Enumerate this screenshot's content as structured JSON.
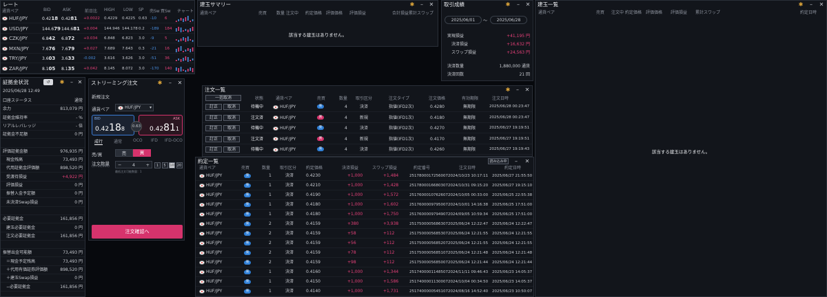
{
  "rates": {
    "title": "レート",
    "cols": [
      "通貨ペア",
      "BID",
      "ASK",
      "前日比",
      "HIGH",
      "LOW",
      "SP",
      "売Sw",
      "買Sw",
      "チャート"
    ],
    "rows": [
      {
        "pair": "HUF/JPY",
        "bid_a": "0.42",
        "bid_b": "18",
        "ask_a": "0.42",
        "ask_b": "81",
        "chg": "+0.0022",
        "high": "0.4229",
        "low": "0.4225",
        "sp": "0.63",
        "sw_sell": "-10",
        "sw_buy": "6",
        "chg_color": "red"
      },
      {
        "pair": "USD/JPY",
        "bid_a": "144.6",
        "bid_b": "79",
        "ask_a": "144.6",
        "ask_b": "81",
        "chg": "+0.004",
        "high": "144.946",
        "low": "144.178",
        "sp": "0.2",
        "sw_sell": "-189",
        "sw_buy": "184",
        "chg_color": "red"
      },
      {
        "pair": "CZK/JPY",
        "bid_a": "6.8",
        "bid_b": "42",
        "ask_a": "6.8",
        "ask_b": "72",
        "chg": "+0.034",
        "high": "6.848",
        "low": "6.823",
        "sp": "3.0",
        "sw_sell": "-9",
        "sw_buy": "5",
        "chg_color": "red"
      },
      {
        "pair": "MXN/JPY",
        "bid_a": "7.6",
        "bid_b": "76",
        "ask_a": "7.6",
        "ask_b": "79",
        "chg": "+0.027",
        "high": "7.689",
        "low": "7.643",
        "sp": "0.3",
        "sw_sell": "-21",
        "sw_buy": "16",
        "chg_color": "red"
      },
      {
        "pair": "TRY/JPY",
        "bid_a": "3.6",
        "bid_b": "03",
        "ask_a": "3.6",
        "ask_b": "33",
        "chg": "-0.002",
        "high": "3.616",
        "low": "3.626",
        "sp": "3.0",
        "sw_sell": "-51",
        "sw_buy": "36",
        "chg_color": "blu"
      },
      {
        "pair": "ZAR/JPY",
        "bid_a": "8.1",
        "bid_b": "05",
        "ask_a": "8.1",
        "ask_b": "35",
        "chg": "+0.042",
        "high": "8.145",
        "low": "8.072",
        "sp": "3.0",
        "sw_sell": "-170",
        "sw_buy": "140",
        "chg_color": "red"
      }
    ]
  },
  "margin": {
    "title": "証拠金状況",
    "datetime": "2025/06/28 12:49",
    "rows": [
      {
        "label": "口座ステータス",
        "value": "通常"
      },
      {
        "label": "余力",
        "value": "813,079 円"
      },
      {
        "label": "証拠金維持率",
        "value": "- %"
      },
      {
        "label": "リアルレバレッジ",
        "value": "- 倍"
      },
      {
        "label": "証拠金不足額",
        "value": "0 円"
      },
      {
        "label": "",
        "value": ""
      },
      {
        "label": "評価証拠金額",
        "value": "976,935 円"
      },
      {
        "label": "現金残高",
        "value": "73,493 円"
      },
      {
        "label": "代用証拠金評価額",
        "value": "898,520 円"
      },
      {
        "label": "受渡待損益",
        "value": "+4,922 円",
        "color": "red"
      },
      {
        "label": "評価損益",
        "value": "0 円"
      },
      {
        "label": "振替入金予定額",
        "value": "0 円"
      },
      {
        "label": "未決済Swap損益",
        "value": "0 円"
      },
      {
        "label": "",
        "value": ""
      },
      {
        "label": "必要証拠金",
        "value": "161,856 円"
      },
      {
        "label": "建玉必要証拠金",
        "value": "0 円"
      },
      {
        "label": "注文必要証拠金",
        "value": "161,856 円"
      },
      {
        "label": "",
        "value": ""
      },
      {
        "label": "振替出金可能額",
        "value": "73,493 円"
      },
      {
        "label": "＝現金予定残高",
        "value": "73,493 円"
      },
      {
        "label": "＋代用有価証券評価額",
        "value": "898,520 円"
      },
      {
        "label": "＋建玉Swap損益",
        "value": "0 円"
      },
      {
        "label": "−必要証拠金",
        "value": "161,856 円"
      }
    ]
  },
  "streaming": {
    "title": "ストリーミング注文",
    "sub": "新規注文",
    "pair_label": "通貨ペア",
    "pair": "HUF/JPY",
    "bid_label": "BID",
    "bid_a": "0.42",
    "bid_b": "18",
    "bid_c": "8",
    "ask_label": "ASK",
    "ask_a": "0.42",
    "ask_b": "81",
    "ask_c": "1",
    "spread": "0.63",
    "tabs": [
      "成行",
      "通常",
      "OCO",
      "IFD",
      "IFD-OCO"
    ],
    "side_label": "売/買",
    "sell": "売",
    "buy": "買",
    "qty_label": "注文数量",
    "qty_unit": "(1=10,000)",
    "qty": "4",
    "qty_note": "最低注文可能数量：1",
    "steps": [
      "1",
      "5",
      "10",
      "20"
    ],
    "submit": "注文確認へ"
  },
  "summary": {
    "title": "建玉サマリー",
    "cols": [
      "通貨ペア",
      "売買",
      "数量",
      "注文中",
      "約定価格",
      "評価価格",
      "評価損益",
      "合計損益",
      "累計スワップ"
    ],
    "empty": "該当する建玉はありません。"
  },
  "trades": {
    "title": "取引成績",
    "from": "2025/06/01",
    "sep": "〜",
    "to": "2025/06/28",
    "rows": [
      {
        "label": "実現損益",
        "value": "+41,195 円",
        "color": "red"
      },
      {
        "label": "決済損益",
        "value": "+16,632 円",
        "color": "red"
      },
      {
        "label": "スワップ損益",
        "value": "+24,563 円",
        "color": "red"
      },
      {
        "label": "決済数量",
        "value": "1,880,000 通貨"
      },
      {
        "label": "決済回数",
        "value": "21 回"
      }
    ]
  },
  "positions": {
    "title": "建玉一覧",
    "cols": [
      "通貨ペア",
      "売買",
      "注文中",
      "約定価格",
      "評価価格",
      "評価損益",
      "累計スワップ",
      "約定日時"
    ],
    "empty": "該当する建玉はありません。"
  },
  "orders": {
    "title": "注文一覧",
    "cancel_all": "一括取消",
    "cols": [
      "状態",
      "通貨ペア",
      "売買",
      "数量",
      "取引区分",
      "注文タイプ",
      "注文価格",
      "有効期限",
      "注文日時"
    ],
    "rows": [
      {
        "b1": "訂正",
        "b2": "取消",
        "status": "待機中",
        "pair": "HUF/JPY",
        "side": "売",
        "sideclass": "s",
        "qty": "4",
        "kind": "決済",
        "type": "指値(IFD2次)",
        "price": "0.4280",
        "exp": "無期限",
        "date": "2025/06/28 00:23:47"
      },
      {
        "b1": "訂正",
        "b2": "取消",
        "status": "注文済",
        "pair": "HUF/JPY",
        "side": "買",
        "sideclass": "b",
        "qty": "4",
        "kind": "新規",
        "type": "指値(IFD1次)",
        "price": "0.4180",
        "exp": "無期限",
        "date": "2025/06/28 00:23:47"
      },
      {
        "b1": "訂正",
        "b2": "取消",
        "status": "待機中",
        "pair": "HUF/JPY",
        "side": "売",
        "sideclass": "s",
        "qty": "4",
        "kind": "決済",
        "type": "指値(IFD2次)",
        "price": "0.4270",
        "exp": "無期限",
        "date": "2025/06/27 19:19:51"
      },
      {
        "b1": "訂正",
        "b2": "取消",
        "status": "注文済",
        "pair": "HUF/JPY",
        "side": "買",
        "sideclass": "b",
        "qty": "4",
        "kind": "新規",
        "type": "指値(IFD1次)",
        "price": "0.4170",
        "exp": "無期限",
        "date": "2025/06/27 19:19:51"
      },
      {
        "b1": "訂正",
        "b2": "取消",
        "status": "待機中",
        "pair": "HUF/JPY",
        "side": "売",
        "sideclass": "s",
        "qty": "4",
        "kind": "決済",
        "type": "指値(IFD2次)",
        "price": "0.4260",
        "exp": "無期限",
        "date": "2025/06/27 19:19:43"
      }
    ]
  },
  "executions": {
    "title": "約定一覧",
    "readmore": "読み込み中",
    "cols": [
      "通貨ペア",
      "売買",
      "数量",
      "取引区分",
      "約定価格",
      "決済損益",
      "スワップ損益",
      "約定番号",
      "注文日時",
      "約定日時"
    ],
    "rows": [
      {
        "pair": "HUF/JPY",
        "side": "売",
        "sideclass": "s",
        "qty": "1",
        "kind": "決済",
        "price": "0.4230",
        "pl": "+1,000",
        "swap": "+1,484",
        "no": "2517800017256007",
        "odate": "2024/10/23 10:17:11",
        "edate": "2025/06/27 21:55:50"
      },
      {
        "pair": "HUF/JPY",
        "side": "売",
        "sideclass": "s",
        "qty": "1",
        "kind": "決済",
        "price": "0.4210",
        "pl": "+1,000",
        "swap": "+1,428",
        "no": "2517800016680307",
        "odate": "2024/10/31 09:15:20",
        "edate": "2025/06/27 19:15:10"
      },
      {
        "pair": "HUF/JPY",
        "side": "売",
        "sideclass": "s",
        "qty": "1",
        "kind": "決済",
        "price": "0.4190",
        "pl": "+1,000",
        "swap": "+1,572",
        "no": "2517600010762607",
        "odate": "2024/10/05 00:33:00",
        "edate": "2025/06/25 22:55:38"
      },
      {
        "pair": "HUF/JPY",
        "side": "売",
        "sideclass": "s",
        "qty": "1",
        "kind": "決済",
        "price": "0.4180",
        "pl": "+1,000",
        "swap": "+1,602",
        "no": "2517600009795007",
        "odate": "2024/10/01 14:16:38",
        "edate": "2025/06/25 17:51:00"
      },
      {
        "pair": "HUF/JPY",
        "side": "売",
        "sideclass": "s",
        "qty": "1",
        "kind": "決済",
        "price": "0.4180",
        "pl": "+1,000",
        "swap": "+1,750",
        "no": "2517600009794907",
        "odate": "2024/09/05 10:59:34",
        "edate": "2025/06/25 17:51:00"
      },
      {
        "pair": "HUF/JPY",
        "side": "売",
        "sideclass": "s",
        "qty": "2",
        "kind": "決済",
        "price": "0.4159",
        "pl": "+380",
        "swap": "+3,938",
        "no": "2517500005686307",
        "odate": "2025/06/24 12:22:47",
        "edate": "2025/06/24 12:22:47"
      },
      {
        "pair": "HUF/JPY",
        "side": "売",
        "sideclass": "s",
        "qty": "2",
        "kind": "決済",
        "price": "0.4159",
        "pl": "+58",
        "swap": "+112",
        "no": "2517500005685307",
        "odate": "2025/06/24 12:21:55",
        "edate": "2025/06/24 12:21:55"
      },
      {
        "pair": "HUF/JPY",
        "side": "売",
        "sideclass": "s",
        "qty": "2",
        "kind": "決済",
        "price": "0.4159",
        "pl": "+56",
        "swap": "+112",
        "no": "2517500005685207",
        "odate": "2025/06/24 12:21:55",
        "edate": "2025/06/24 12:21:55"
      },
      {
        "pair": "HUF/JPY",
        "side": "売",
        "sideclass": "s",
        "qty": "2",
        "kind": "決済",
        "price": "0.4159",
        "pl": "+78",
        "swap": "+112",
        "no": "2517500005685107",
        "odate": "2025/06/24 12:21:48",
        "edate": "2025/06/24 12:21:48"
      },
      {
        "pair": "HUF/JPY",
        "side": "売",
        "sideclass": "s",
        "qty": "2",
        "kind": "決済",
        "price": "0.4159",
        "pl": "+98",
        "swap": "+112",
        "no": "2517500005685007",
        "odate": "2025/06/24 12:21:44",
        "edate": "2025/06/24 12:21:44"
      },
      {
        "pair": "HUF/JPY",
        "side": "売",
        "sideclass": "s",
        "qty": "1",
        "kind": "決済",
        "price": "0.4160",
        "pl": "+1,000",
        "swap": "+1,344",
        "no": "2517400001148507",
        "odate": "2024/11/11 09:46:43",
        "edate": "2025/06/23 14:05:37"
      },
      {
        "pair": "HUF/JPY",
        "side": "売",
        "sideclass": "s",
        "qty": "1",
        "kind": "決済",
        "price": "0.4150",
        "pl": "+1,000",
        "swap": "+1,586",
        "no": "2517400001130007",
        "odate": "2024/10/04 00:34:50",
        "edate": "2025/06/23 14:05:37"
      },
      {
        "pair": "HUF/JPY",
        "side": "売",
        "sideclass": "s",
        "qty": "1",
        "kind": "決済",
        "price": "0.4140",
        "pl": "+1,000",
        "swap": "+1,731",
        "no": "2517400000545107",
        "odate": "2024/08/16 14:52:40",
        "edate": "2025/06/23 10:50:07"
      }
    ]
  }
}
